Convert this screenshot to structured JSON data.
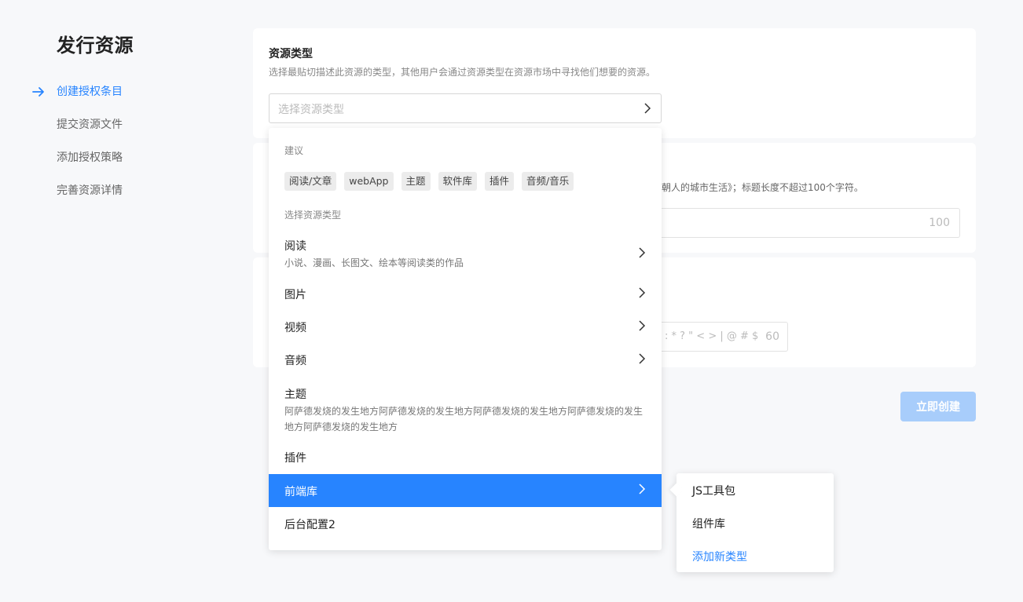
{
  "page_title": "发行资源",
  "steps": [
    {
      "label": "创建授权条目",
      "active": true
    },
    {
      "label": "提交资源文件",
      "active": false
    },
    {
      "label": "添加授权策略",
      "active": false
    },
    {
      "label": "完善资源详情",
      "active": false
    }
  ],
  "resource_type": {
    "title": "资源类型",
    "desc": "选择最贴切描述此资源的类型，其他用户会通过资源类型在资源市场中寻找他们想要的资源。",
    "placeholder": "选择资源类型"
  },
  "title_section": {
    "partial_desc": "朝人的城市生活》；标题长度不超过100个字符。",
    "counter": "100"
  },
  "name_section": {
    "hint": ": * ? \" < > | @ # $",
    "counter": "60"
  },
  "create_button": "立即创建",
  "dropdown": {
    "suggest_label": "建议",
    "chips": [
      "阅读/文章",
      "webApp",
      "主题",
      "软件库",
      "插件",
      "音频/音乐"
    ],
    "types_label": "选择资源类型",
    "items": [
      {
        "title": "阅读",
        "desc": "小说、漫画、长图文、绘本等阅读类的作品",
        "has_children": true
      },
      {
        "title": "图片",
        "desc": "",
        "has_children": true
      },
      {
        "title": "视频",
        "desc": "",
        "has_children": true
      },
      {
        "title": "音频",
        "desc": "",
        "has_children": true
      },
      {
        "title": "主题",
        "desc": "阿萨德发烧的发生地方阿萨德发烧的发生地方阿萨德发烧的发生地方阿萨德发烧的发生地方阿萨德发烧的发生地方",
        "has_children": false
      },
      {
        "title": "插件",
        "desc": "",
        "has_children": false
      },
      {
        "title": "前端库",
        "desc": "",
        "has_children": true,
        "selected": true
      },
      {
        "title": "后台配置2",
        "desc": "",
        "has_children": false
      }
    ]
  },
  "submenu": {
    "items": [
      "JS工具包",
      "组件库"
    ],
    "add_label": "添加新类型"
  },
  "colors": {
    "accent": "#2784ff",
    "disabled_button": "#a8cdfb"
  }
}
